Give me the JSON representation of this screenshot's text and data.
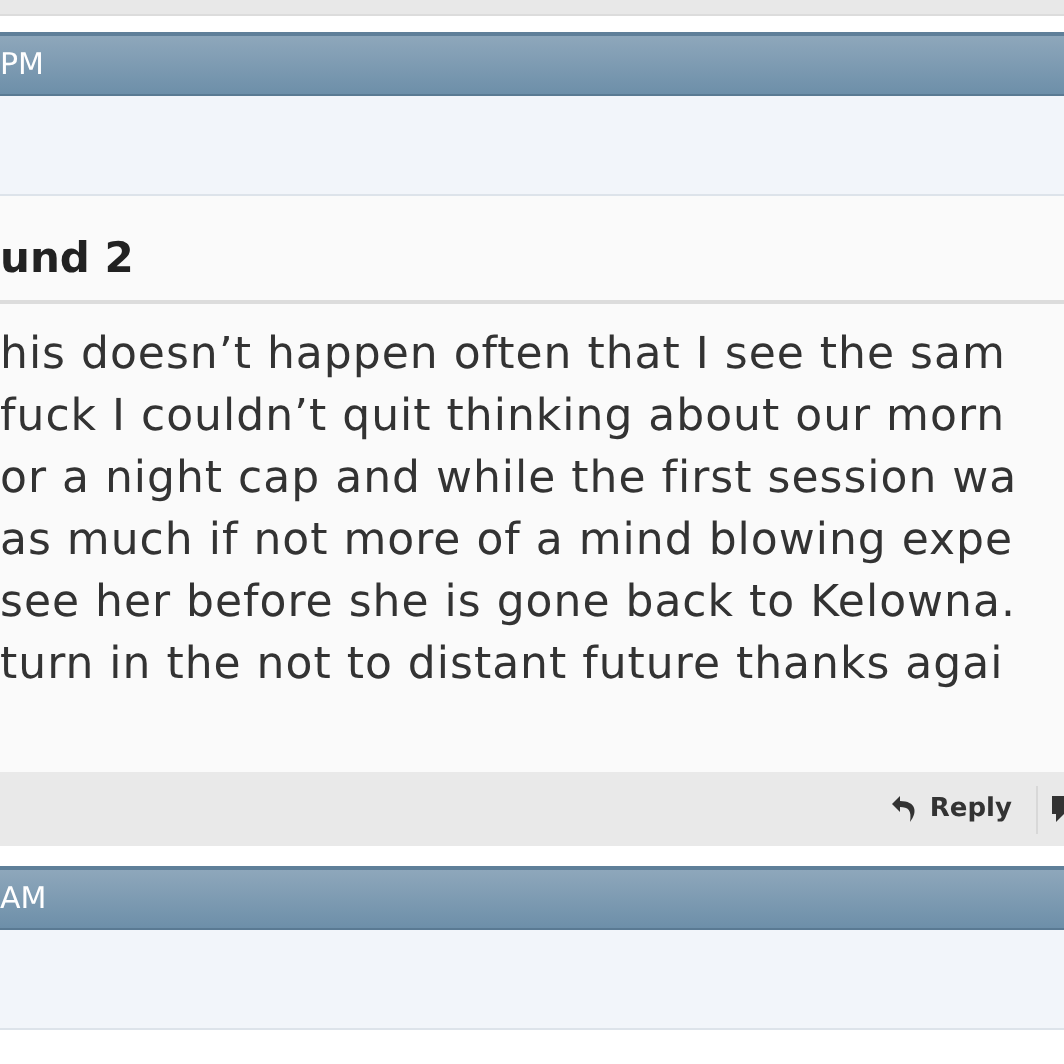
{
  "posts": [
    {
      "header_time": "PM",
      "title": "und 2",
      "body_lines": [
        "his doesn’t happen often that I see the sam",
        "fuck I couldn’t quit thinking about our morn",
        "or a night cap and while the first session wa",
        "as much if not more of a mind blowing expe",
        "see her before she is gone back to Kelowna.",
        "turn in the not to distant future thanks agai"
      ],
      "actions": [
        "Reply"
      ]
    },
    {
      "header_time": "AM"
    }
  ]
}
